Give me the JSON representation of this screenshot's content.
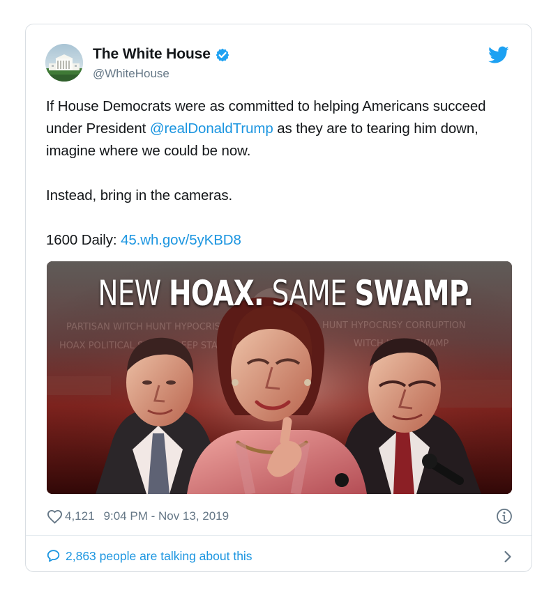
{
  "tweet": {
    "author": {
      "display_name": "The White House",
      "handle": "@WhiteHouse",
      "verified": true,
      "avatar_icon": "white-house-avatar"
    },
    "body": {
      "line1_before_mention": "If House Democrats were as committed to helping Americans succeed under President ",
      "mention": "@realDonaldTrump",
      "line1_after_mention": " as they are to tearing him down, imagine where we could be now.",
      "paragraph2": "Instead, bring in the cameras.",
      "link_prefix": "1600 Daily: ",
      "link_text": "45.wh.gov/5yKBD8"
    },
    "image": {
      "headline_word1": "NEW",
      "headline_word2": "HOAX.",
      "headline_word3": "SAME",
      "headline_word4": "SWAMP."
    },
    "meta": {
      "likes": "4,121",
      "timestamp": "9:04 PM - Nov 13, 2019"
    },
    "conversation": {
      "label": "2,863 people are talking about this"
    }
  },
  "colors": {
    "twitter_blue": "#1da1f2",
    "link_blue": "#1b95e0",
    "muted_text": "#657786",
    "border": "#d9dee3",
    "image_red": "#6f1111"
  },
  "icons": {
    "verified": "verified-badge-icon",
    "brand": "twitter-bird-icon",
    "like": "heart-icon",
    "info": "info-icon",
    "conversation": "comment-icon",
    "chevron": "chevron-right-icon"
  }
}
